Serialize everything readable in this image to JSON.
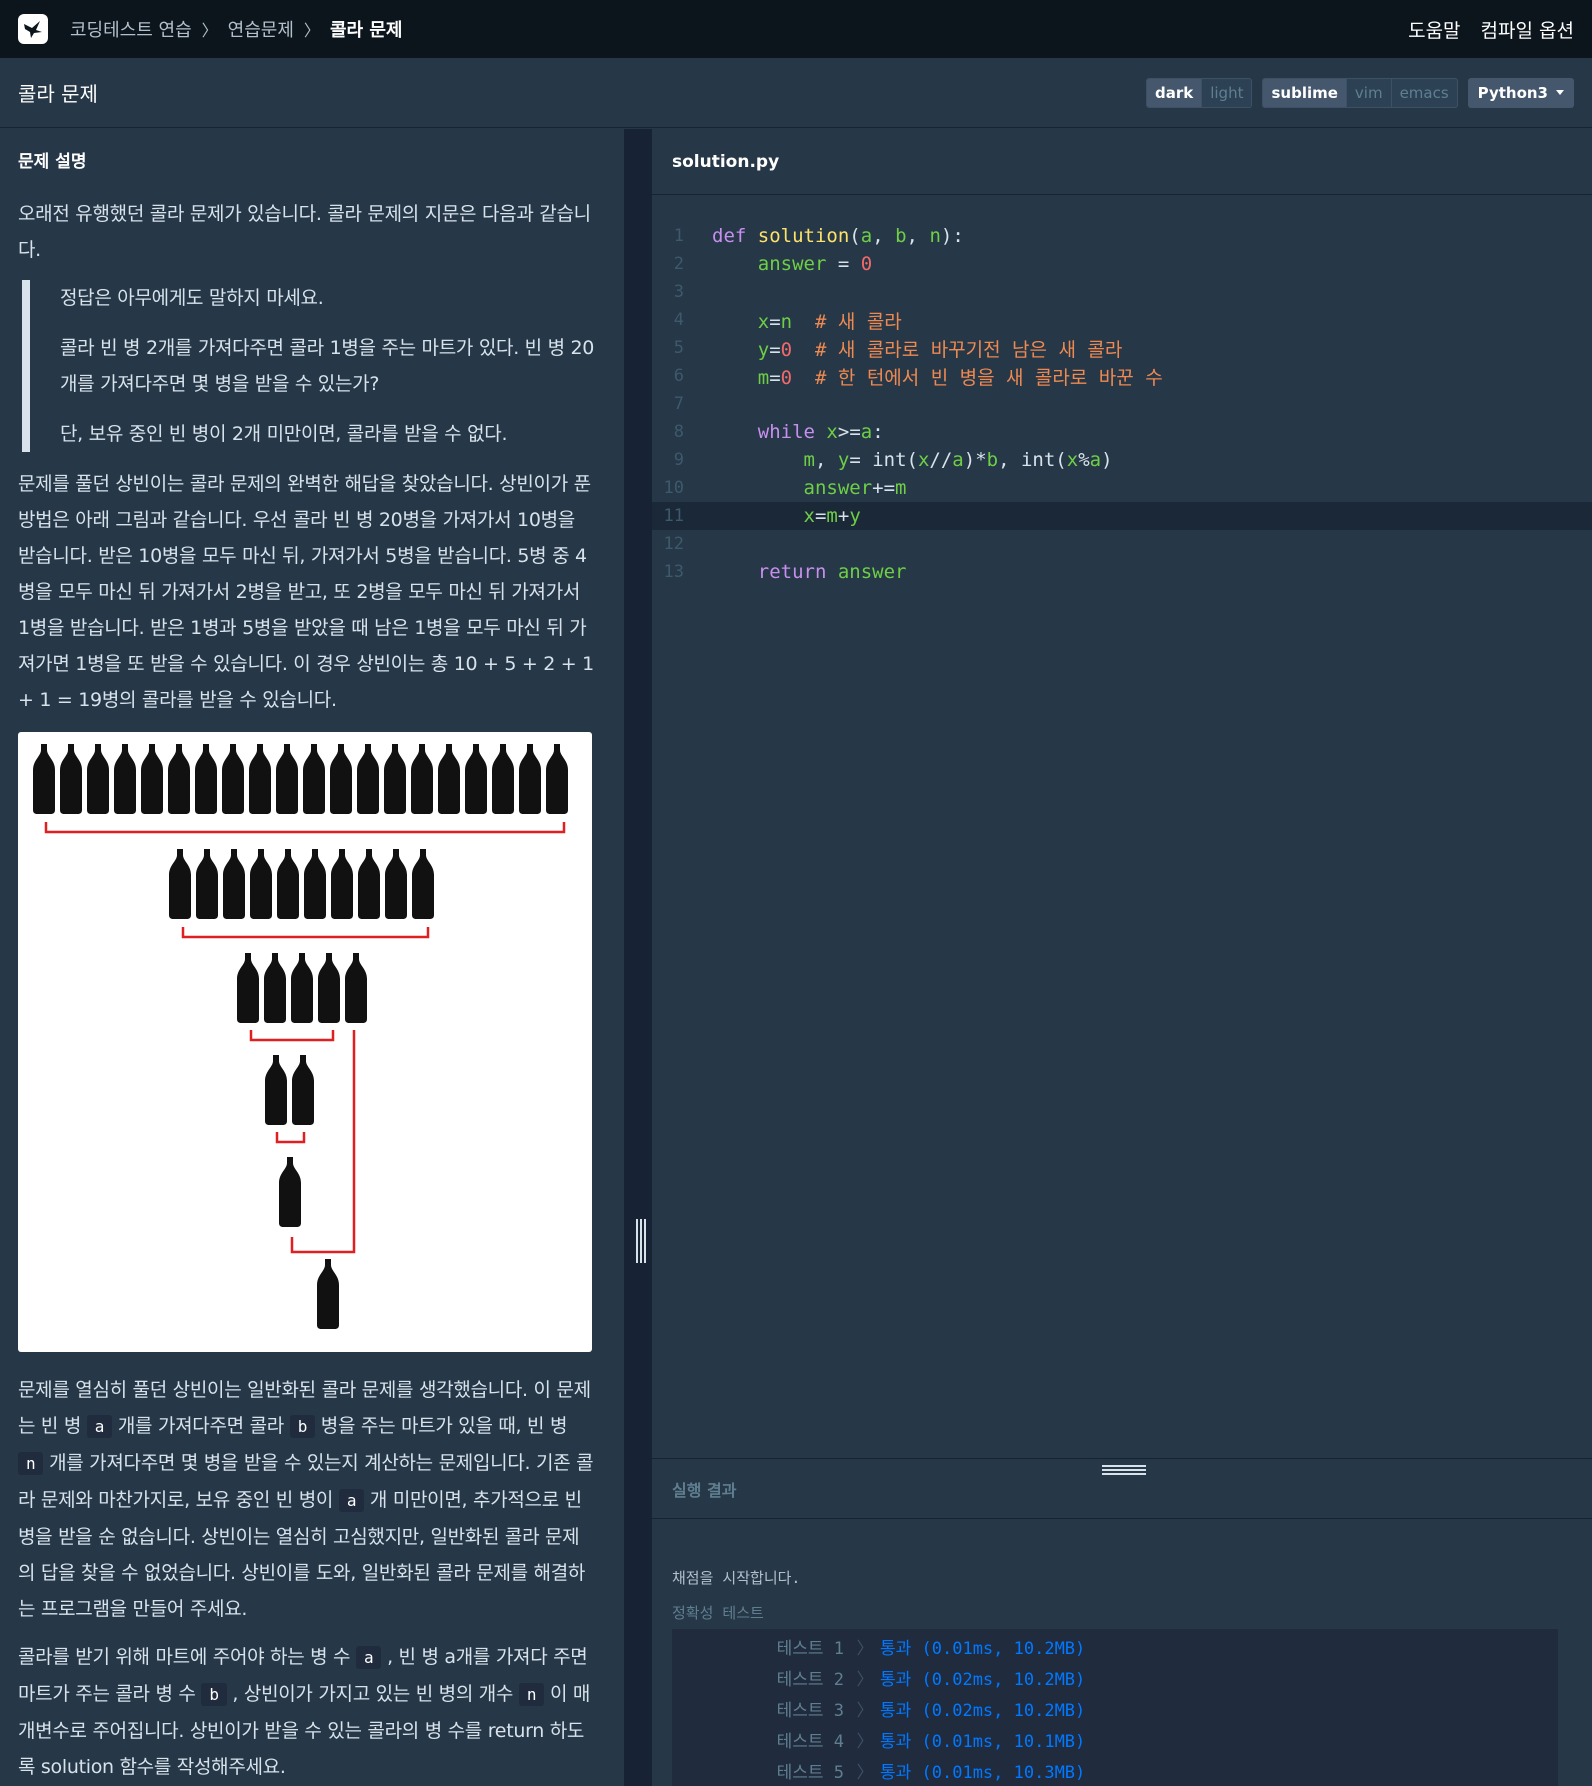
{
  "nav": {
    "crumbs": [
      "코딩테스트 연습",
      "연습문제",
      "콜라 문제"
    ],
    "help": "도움말",
    "compile_options": "컴파일 옵션"
  },
  "titlebar": {
    "title": "콜라 문제",
    "themes": [
      "dark",
      "light"
    ],
    "keymaps": [
      "sublime",
      "vim",
      "emacs"
    ],
    "language": "Python3"
  },
  "problem": {
    "heading": "문제 설명",
    "intro": "오래전 유행했던 콜라 문제가 있습니다. 콜라 문제의 지문은 다음과 같습니다.",
    "quote": [
      "정답은 아무에게도 말하지 마세요.",
      "콜라 빈 병 2개를 가져다주면 콜라 1병을 주는 마트가 있다. 빈 병 20개를 가져다주면 몇 병을 받을 수 있는가?",
      "단, 보유 중인 빈 병이 2개 미만이면, 콜라를 받을 수 없다."
    ],
    "explain": "문제를 풀던 상빈이는 콜라 문제의 완벽한 해답을 찾았습니다. 상빈이가 푼 방법은 아래 그림과 같습니다. 우선 콜라 빈 병 20병을 가져가서 10병을 받습니다. 받은 10병을 모두 마신 뒤, 가져가서 5병을 받습니다. 5병 중 4병을 모두 마신 뒤 가져가서 2병을 받고, 또 2병을 모두 마신 뒤 가져가서 1병을 받습니다. 받은 1병과 5병을 받았을 때 남은 1병을 모두 마신 뒤 가져가면 1병을 또 받을 수 있습니다. 이 경우 상빈이는 총 10 + 5 + 2 + 1 + 1 = 19병의 콜라를 받을 수 있습니다.",
    "general": {
      "p1": "문제를 열심히 풀던 상빈이는 일반화된 콜라 문제를 생각했습니다. 이 문제는 빈 병 ",
      "p2": " 개를 가져다주면 콜라 ",
      "p3": " 병을 주는 마트가 있을 때, 빈 병 ",
      "p4": " 개를 가져다주면 몇 병을 받을 수 있는지 계산하는 문제입니다. 기존 콜라 문제와 마찬가지로, 보유 중인 빈 병이 ",
      "p5": " 개 미만이면, 추가적으로 빈 병을 받을 순 없습니다. 상빈이는 열심히 고심했지만, 일반화된 콜라 문제의 답을 찾을 수 없었습니다. 상빈이를 도와, 일반화된 콜라 문제를 해결하는 프로그램을 만들어 주세요."
    },
    "params": {
      "p1": "콜라를 받기 위해 마트에 주어야 하는 병 수 ",
      "p2": " , 빈 병 a개를 가져다 주면 마트가 주는 콜라 병 수 ",
      "p3": " , 상빈이가 가지고 있는 빈 병의 개수 ",
      "p4": " 이 매개변수로 주어집니다. 상빈이가 받을 수 있는 콜라의 병 수를 return 하도록 solution 함수를 작성해주세요."
    },
    "var_a": "a",
    "var_b": "b",
    "var_n": "n",
    "figure_rows": [
      20,
      10,
      5,
      2,
      1,
      1
    ]
  },
  "editor": {
    "filename": "solution.py",
    "line_numbers": [
      "1",
      "2",
      "3",
      "4",
      "5",
      "6",
      "7",
      "8",
      "9",
      "10",
      "11",
      "12",
      "13"
    ]
  },
  "result": {
    "heading": "실행 결과",
    "start": "채점을 시작합니다.",
    "accuracy_label": "정확성  테스트",
    "tests": [
      {
        "name": "테스트 1",
        "result": "통과 (0.01ms, 10.2MB)"
      },
      {
        "name": "테스트 2",
        "result": "통과 (0.02ms, 10.2MB)"
      },
      {
        "name": "테스트 3",
        "result": "통과 (0.02ms, 10.2MB)"
      },
      {
        "name": "테스트 4",
        "result": "통과 (0.01ms, 10.1MB)"
      },
      {
        "name": "테스트 5",
        "result": "통과 (0.01ms, 10.3MB)"
      }
    ]
  }
}
